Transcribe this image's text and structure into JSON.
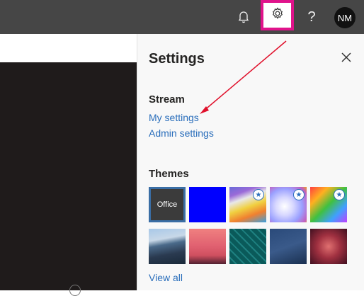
{
  "topbar": {
    "bell_icon": "bell-icon",
    "gear_icon": "gear-icon",
    "help_label": "?",
    "avatar_initials": "NM"
  },
  "settings": {
    "title": "Settings",
    "close_icon": "close-icon",
    "stream_heading": "Stream",
    "links": [
      "My settings",
      "Admin settings"
    ],
    "themes_heading": "Themes",
    "view_all": "View all",
    "themes": [
      {
        "label": "Office",
        "selected": true
      },
      {
        "color": "#0000ff"
      },
      {
        "name": "rainbow",
        "starred": true
      },
      {
        "name": "abstract",
        "starred": true
      },
      {
        "name": "unicorn",
        "starred": true
      },
      {
        "name": "mountain"
      },
      {
        "name": "palms"
      },
      {
        "name": "circuit"
      },
      {
        "name": "ocean"
      },
      {
        "name": "bokeh"
      }
    ]
  },
  "colors": {
    "accent_link": "#2a6ebb",
    "highlight": "#e0138b",
    "arrow": "#e0102b"
  }
}
